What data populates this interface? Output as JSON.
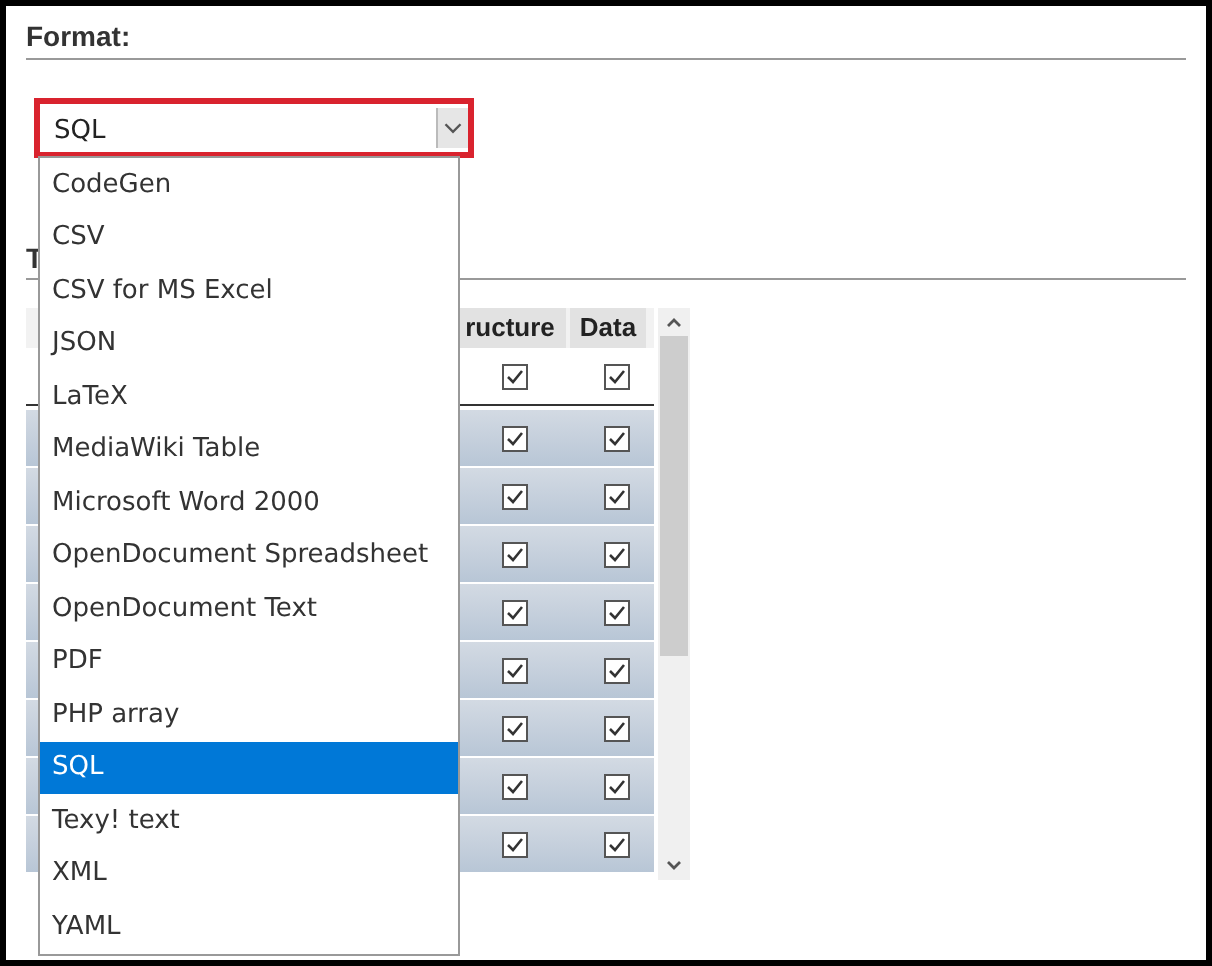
{
  "format": {
    "heading": "Format:",
    "select": {
      "value": "SQL",
      "highlighted": true,
      "expanded": true
    },
    "options": [
      {
        "label": "CodeGen",
        "selected": false
      },
      {
        "label": "CSV",
        "selected": false
      },
      {
        "label": "CSV for MS Excel",
        "selected": false
      },
      {
        "label": "JSON",
        "selected": false
      },
      {
        "label": "LaTeX",
        "selected": false
      },
      {
        "label": "MediaWiki Table",
        "selected": false
      },
      {
        "label": "Microsoft Word 2000",
        "selected": false
      },
      {
        "label": "OpenDocument Spreadsheet",
        "selected": false
      },
      {
        "label": "OpenDocument Text",
        "selected": false
      },
      {
        "label": "PDF",
        "selected": false
      },
      {
        "label": "PHP array",
        "selected": false
      },
      {
        "label": "SQL",
        "selected": true
      },
      {
        "label": "Texy! text",
        "selected": false
      },
      {
        "label": "XML",
        "selected": false
      },
      {
        "label": "YAML",
        "selected": false
      }
    ]
  },
  "tables": {
    "heading": "T",
    "columns": [
      "ructure",
      "Data"
    ],
    "rows": [
      {
        "structure": true,
        "data": true
      },
      {
        "structure": true,
        "data": true
      },
      {
        "structure": true,
        "data": true
      },
      {
        "structure": true,
        "data": true
      },
      {
        "structure": true,
        "data": true
      },
      {
        "structure": true,
        "data": true
      },
      {
        "structure": true,
        "data": true
      },
      {
        "structure": true,
        "data": true
      },
      {
        "structure": true,
        "data": true
      }
    ]
  }
}
